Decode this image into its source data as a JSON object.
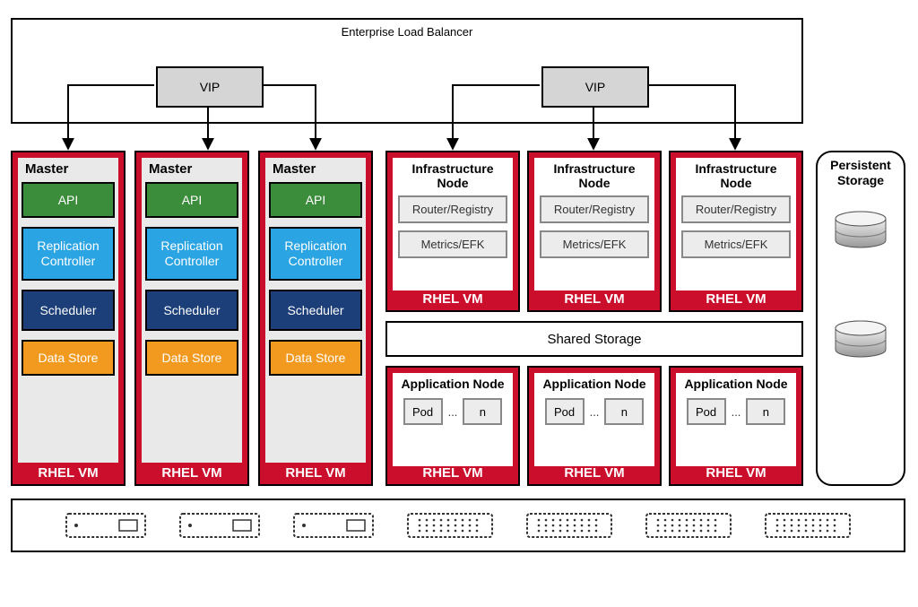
{
  "elb": {
    "title": "Enterprise Load Balancer",
    "vip1": "VIP",
    "vip2": "VIP"
  },
  "masters": {
    "title": "Master",
    "api": "API",
    "repctl": "Replication Controller",
    "scheduler": "Scheduler",
    "datastore": "Data Store",
    "footer": "RHEL VM"
  },
  "infra": {
    "title": "Infrastructure Node",
    "router": "Router/Registry",
    "metrics": "Metrics/EFK",
    "footer": "RHEL VM"
  },
  "shared_storage": "Shared Storage",
  "app": {
    "title": "Application Node",
    "pod": "Pod",
    "dots": "...",
    "n": "n",
    "footer": "RHEL VM"
  },
  "persistent_storage": {
    "title": "Persistent Storage"
  }
}
